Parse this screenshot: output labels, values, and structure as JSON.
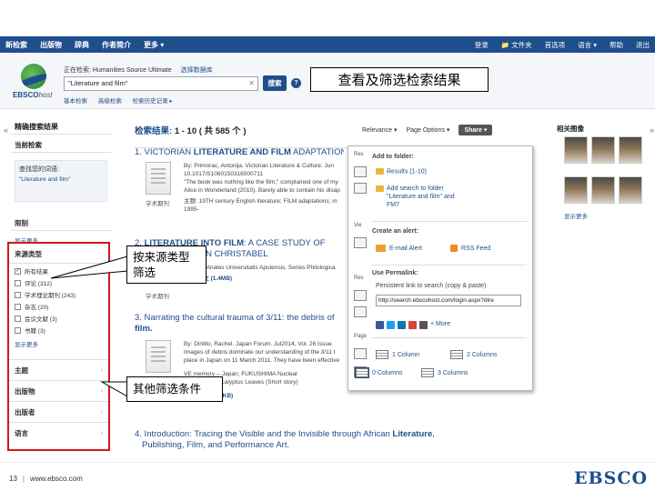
{
  "topbar": {
    "nav": [
      "新检索",
      "出版物",
      "辞典",
      "作者简介",
      "更多 ▾"
    ],
    "right": [
      "登录",
      "📁 文件夹",
      "首选项",
      "语言 ▾",
      "帮助",
      "退出"
    ]
  },
  "search": {
    "database_label": "正在检索: Humanities Source Ultimate",
    "choose_db": "选择数据库",
    "query": "\"Literature and film\"",
    "clear_glyph": "✕",
    "button": "搜索",
    "help": "?",
    "links": [
      "基本检索",
      "高级检索",
      "检索历史记录 ▸"
    ]
  },
  "logo": {
    "text_bold": "EBSCO",
    "text_italic": "host"
  },
  "callouts": {
    "top": "查看及筛选检索结果",
    "source_line1": "按来源类型",
    "source_line2": "筛选",
    "other": "其他筛选条件"
  },
  "left": {
    "refine_title": "精确搜索结果",
    "current_search": "当前检索",
    "find_all_label": "查找您的词语:",
    "find_all_value": "\"Literature and film\"",
    "limit": "限制",
    "show_more": "显示更多",
    "source_type": "来源类型",
    "options": [
      {
        "label": "所有结果",
        "checked": true
      },
      {
        "label": "评论 (312)",
        "checked": false
      },
      {
        "label": "学术理论期刊 (243)",
        "checked": false
      },
      {
        "label": "杂志 (20)",
        "checked": false
      },
      {
        "label": "会议文献 (3)",
        "checked": false
      },
      {
        "label": "书籍 (3)",
        "checked": false
      }
    ],
    "show_more2": "显示更多",
    "facets": [
      "主题",
      "出版物",
      "出版者",
      "语言"
    ]
  },
  "results": {
    "header_prefix": "检索结果:",
    "header_range": "1 - 10",
    "header_total": "( 共 585 个 )",
    "toolbar": [
      "Relevance ▾",
      "Page Options ▾",
      "Share ▾"
    ],
    "records": [
      {
        "title_a": "1. VICTORIAN ",
        "title_b": "LITERATURE AND FILM",
        "title_c": " ADAPTATION",
        "meta": [
          "By: Primorac, Antonija. Victorian Literature & Culture. Jun",
          "10.1017/S1060150316000711",
          "\"The book was nothing like the film,\" complained one of my",
          "Alice in Wonderland (2010). Barely able to contain his disap",
          "主题: 19TH century English literature; FILM adaptations; m",
          "1995-"
        ],
        "type": "学术期刊"
      },
      {
        "title_a": "2. ",
        "title_b": "LITERATURE INTO FILM",
        "title_c": ": A CASE STUDY OF REMINISCENCE IN CHRISTABEL",
        "meta": [
          "EMILIA. Anales Universitatis Apulensis. Series Philologica",
          "PDF 全文 (1.4MB)"
        ],
        "type": "学术期刊"
      },
      {
        "title_a": "3. Narrating the cultural trauma of 3/11: the debris of ",
        "title_b": "film.",
        "title_c": "",
        "meta": [
          "By: Dinitto, Rachel. Japan Forum. Jul2014, Vol. 26 Issue",
          "Images of debris dominate our understanding of the 3/11 t",
          "place in Japan on 11 March 2011. They have been effective",
          "VE memory -- Japan; FUKUSHIMA Nuclear",
          "ing LITTLE Eucalyptus Leaves (Short story)",
          "PDF 全文 (140KB)"
        ],
        "type": "学术期刊"
      },
      {
        "title_a": "4. Introduction: Tracing the Visible and the Invisible through African ",
        "title_b": "Literature",
        "title_c": ",",
        "title_line2": "Publishing, Film, and Performance Art."
      }
    ]
  },
  "popup": {
    "side_labels": [
      "Res",
      "Vie",
      "Res",
      "Page"
    ],
    "add_to_folder": "Add to folder:",
    "results_range": "Results (1-10)",
    "add_search_1": "Add search to folder",
    "add_search_2": "\"Literature and film\" and",
    "add_search_3": "FM7",
    "create_alert": "Create an alert:",
    "email_alert": "E-mail Alert",
    "rss": "RSS Feed",
    "use_permalink": "Use Permalink:",
    "persistent_link": "Persistent link to search (copy & paste)",
    "permalink_value": "http://search.ebscohost.com/login.aspx?dire",
    "more": "+ More",
    "col1": "1 Column",
    "col2": "2 Columns",
    "col0": "0 Columns",
    "col3": "3 Columns",
    "colors": {
      "email": "#f0a030",
      "rss": "#f28a1e",
      "fb": "#3b5998",
      "tw": "#1da1f2",
      "li": "#0e76a8",
      "gp": "#d34836"
    }
  },
  "rightpanel": {
    "title": "相关图像",
    "show_more": "显示更多",
    "arrow": "»"
  },
  "footer": {
    "page": "13",
    "sep": "|",
    "url": "www.ebsco.com",
    "brand": "EBSCO"
  },
  "colors": {
    "brand_blue": "#1f4e8c",
    "highlight_red": "#d01818"
  }
}
